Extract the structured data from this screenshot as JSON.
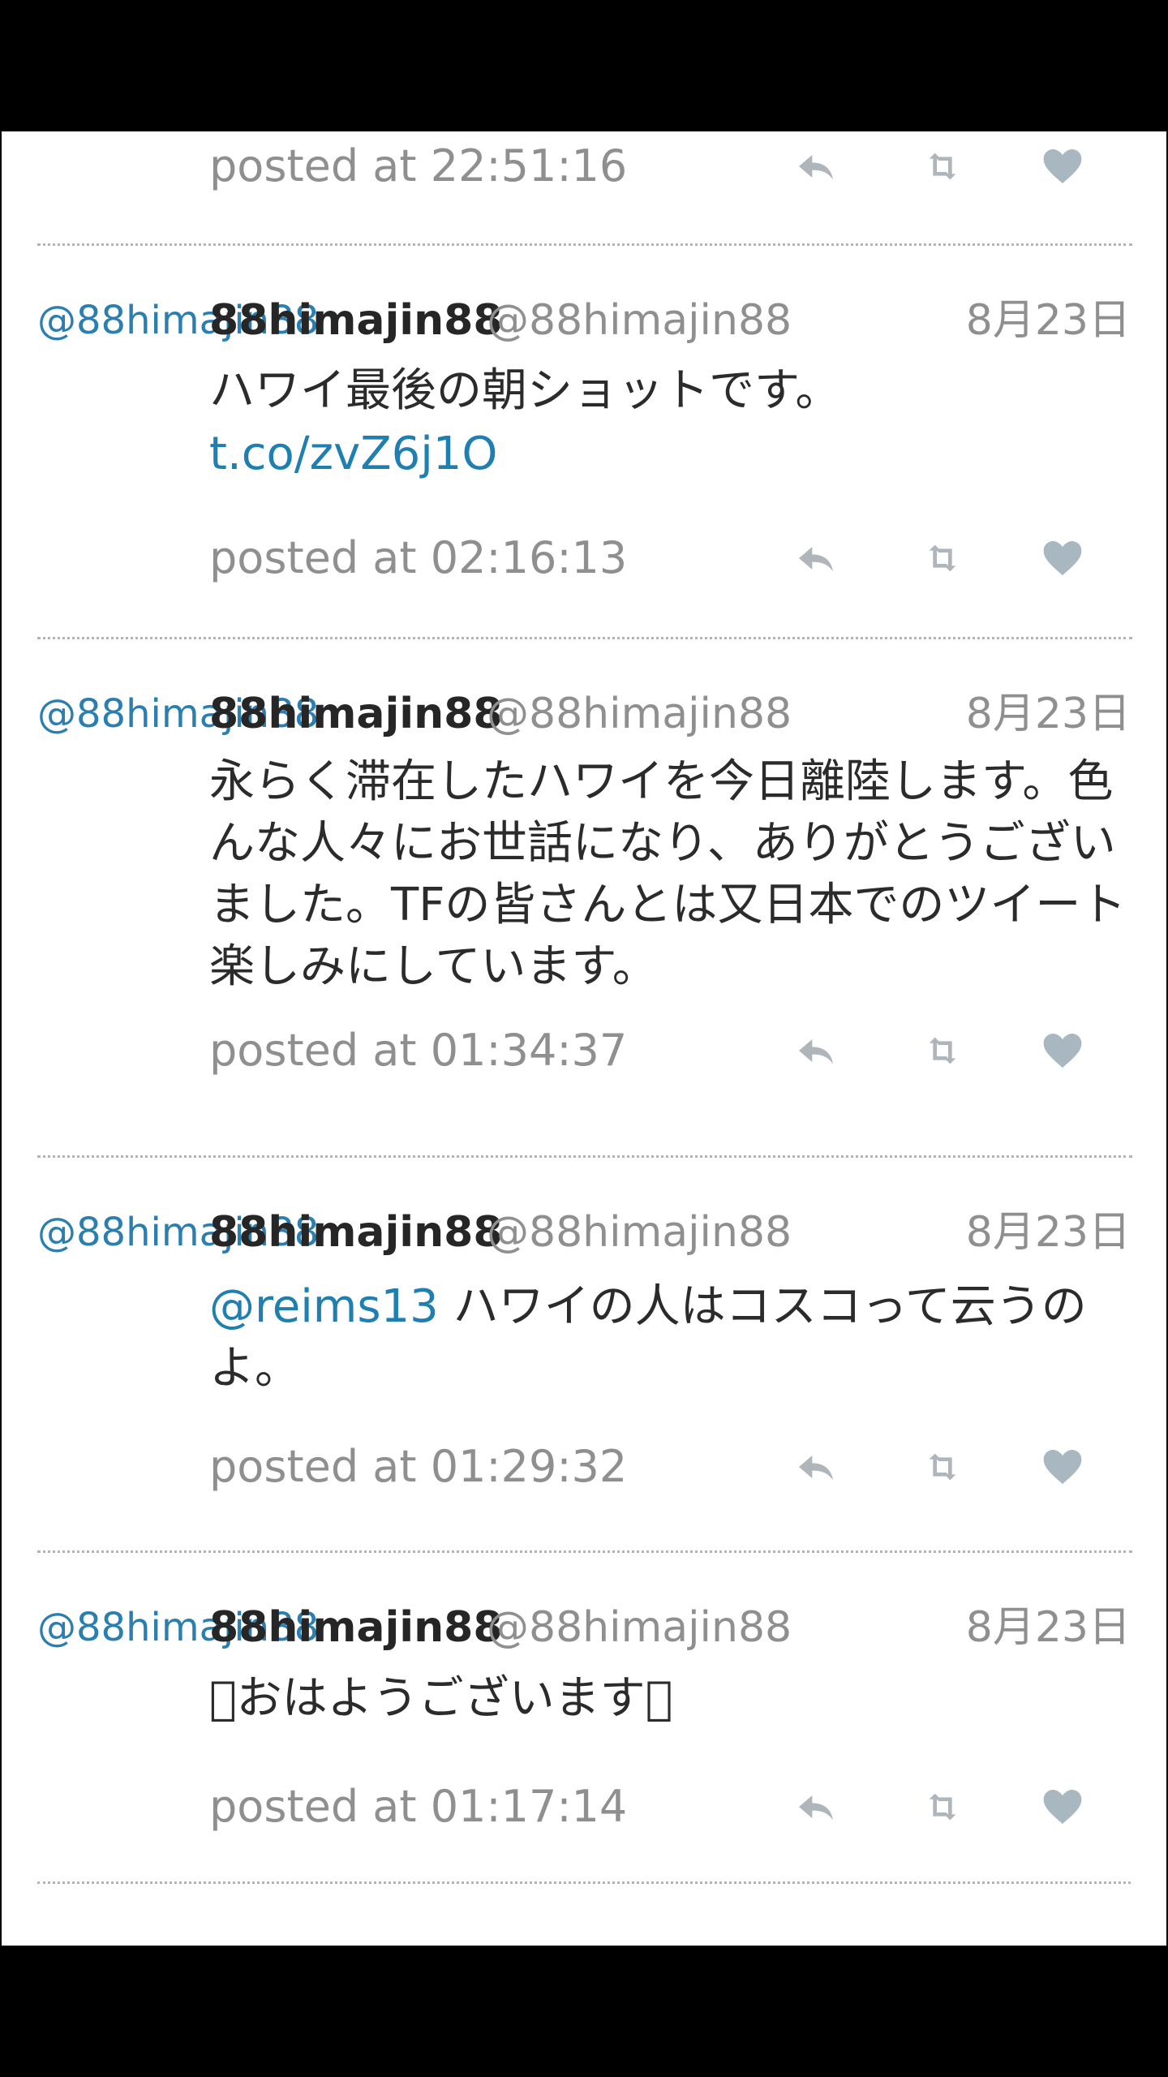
{
  "colors": {
    "link": "#1f7fb0",
    "icon_gray": "#aeb6bc",
    "heart_gray": "#a9b7c1",
    "meta_gray": "#8f8f8f",
    "text_dark": "#2b2b2b"
  },
  "tweets": [
    {
      "posted": "posted at 22:51:16"
    },
    {
      "avatar_alt": "@88himajin88",
      "name": "88himajin88",
      "handle": "@88himajin88",
      "date": "8月23日",
      "text": "ハワイ最後の朝ショットです。",
      "link": "t.co/zvZ6j1O",
      "posted": "posted at 02:16:13"
    },
    {
      "avatar_alt": "@88himajin88",
      "name": "88himajin88",
      "handle": "@88himajin88",
      "date": "8月23日",
      "text": "永らく滞在したハワイを今日離陸します。色んな人々にお世話になり、ありがとうございました。TFの皆さんとは又日本でのツイート楽しみにしています。",
      "posted": "posted at 01:34:37"
    },
    {
      "avatar_alt": "@88himajin88",
      "name": "88himajin88",
      "handle": "@88himajin88",
      "date": "8月23日",
      "mention": "@reims13",
      "text": " ハワイの人はコスコって云うのよ。",
      "posted": "posted at 01:29:32"
    },
    {
      "avatar_alt": "@88himajin88",
      "name": "88himajin88",
      "handle": "@88himajin88",
      "date": "8月23日",
      "text": "\u0000おはようございます\u0000",
      "posted": "posted at 01:17:14"
    }
  ],
  "icons": {
    "reply": "reply-icon",
    "retweet": "retweet-icon",
    "like": "heart-icon"
  }
}
